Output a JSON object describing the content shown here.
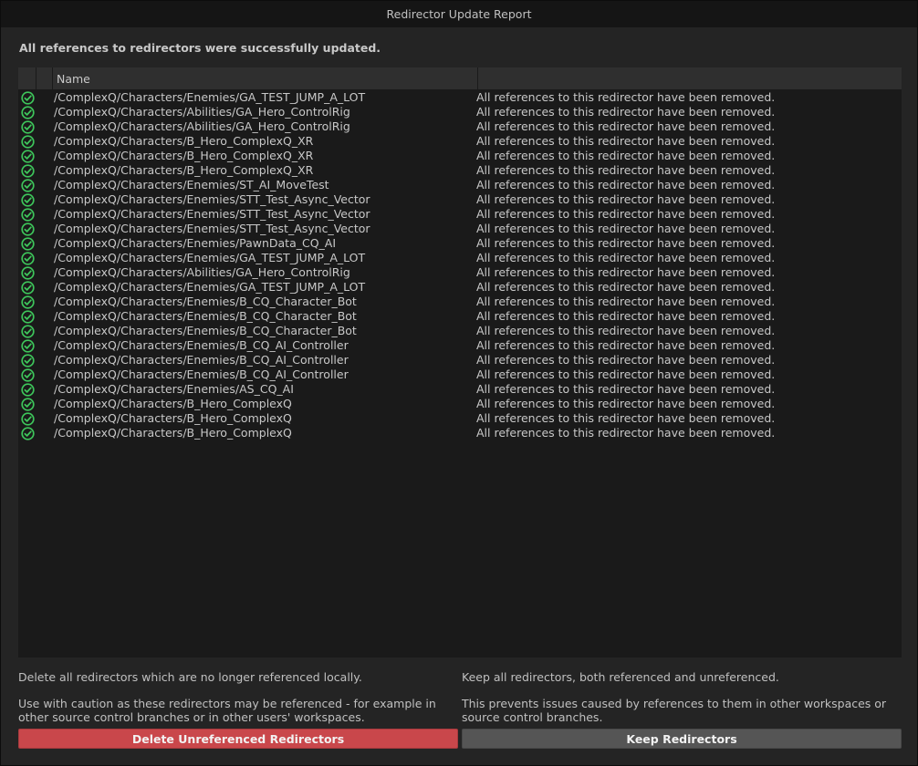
{
  "window": {
    "title": "Redirector Update Report"
  },
  "summary": "All references to redirectors were successfully updated.",
  "table": {
    "columns": {
      "name": "Name",
      "message": ""
    },
    "rows": [
      {
        "name": "/ComplexQ/Characters/Enemies/GA_TEST_JUMP_A_LOT",
        "message": "All references to this redirector have been removed."
      },
      {
        "name": "/ComplexQ/Characters/Abilities/GA_Hero_ControlRig",
        "message": "All references to this redirector have been removed."
      },
      {
        "name": "/ComplexQ/Characters/Abilities/GA_Hero_ControlRig",
        "message": "All references to this redirector have been removed."
      },
      {
        "name": "/ComplexQ/Characters/B_Hero_ComplexQ_XR",
        "message": "All references to this redirector have been removed."
      },
      {
        "name": "/ComplexQ/Characters/B_Hero_ComplexQ_XR",
        "message": "All references to this redirector have been removed."
      },
      {
        "name": "/ComplexQ/Characters/B_Hero_ComplexQ_XR",
        "message": "All references to this redirector have been removed."
      },
      {
        "name": "/ComplexQ/Characters/Enemies/ST_AI_MoveTest",
        "message": "All references to this redirector have been removed."
      },
      {
        "name": "/ComplexQ/Characters/Enemies/STT_Test_Async_Vector",
        "message": "All references to this redirector have been removed."
      },
      {
        "name": "/ComplexQ/Characters/Enemies/STT_Test_Async_Vector",
        "message": "All references to this redirector have been removed."
      },
      {
        "name": "/ComplexQ/Characters/Enemies/STT_Test_Async_Vector",
        "message": "All references to this redirector have been removed."
      },
      {
        "name": "/ComplexQ/Characters/Enemies/PawnData_CQ_AI",
        "message": "All references to this redirector have been removed."
      },
      {
        "name": "/ComplexQ/Characters/Enemies/GA_TEST_JUMP_A_LOT",
        "message": "All references to this redirector have been removed."
      },
      {
        "name": "/ComplexQ/Characters/Abilities/GA_Hero_ControlRig",
        "message": "All references to this redirector have been removed."
      },
      {
        "name": "/ComplexQ/Characters/Enemies/GA_TEST_JUMP_A_LOT",
        "message": "All references to this redirector have been removed."
      },
      {
        "name": "/ComplexQ/Characters/Enemies/B_CQ_Character_Bot",
        "message": "All references to this redirector have been removed."
      },
      {
        "name": "/ComplexQ/Characters/Enemies/B_CQ_Character_Bot",
        "message": "All references to this redirector have been removed."
      },
      {
        "name": "/ComplexQ/Characters/Enemies/B_CQ_Character_Bot",
        "message": "All references to this redirector have been removed."
      },
      {
        "name": "/ComplexQ/Characters/Enemies/B_CQ_AI_Controller",
        "message": "All references to this redirector have been removed."
      },
      {
        "name": "/ComplexQ/Characters/Enemies/B_CQ_AI_Controller",
        "message": "All references to this redirector have been removed."
      },
      {
        "name": "/ComplexQ/Characters/Enemies/B_CQ_AI_Controller",
        "message": "All references to this redirector have been removed."
      },
      {
        "name": "/ComplexQ/Characters/Enemies/AS_CQ_AI",
        "message": "All references to this redirector have been removed."
      },
      {
        "name": "/ComplexQ/Characters/B_Hero_ComplexQ",
        "message": "All references to this redirector have been removed."
      },
      {
        "name": "/ComplexQ/Characters/B_Hero_ComplexQ",
        "message": "All references to this redirector have been removed."
      },
      {
        "name": "/ComplexQ/Characters/B_Hero_ComplexQ",
        "message": "All references to this redirector have been removed."
      }
    ],
    "status_icon": "check-circle-icon"
  },
  "delete_section": {
    "line1": "Delete all redirectors which are no longer referenced locally.",
    "line2": "Use with caution as these redirectors may be referenced - for example in other source control branches or in other users' workspaces.",
    "button_label": "Delete Unreferenced Redirectors"
  },
  "keep_section": {
    "line1": "Keep all redirectors, both referenced and unreferenced.",
    "line2": "This prevents issues caused by references to them in other workspaces or source control branches.",
    "button_label": "Keep Redirectors"
  },
  "colors": {
    "success": "#3ec65b",
    "danger": "#c9474b",
    "neutral": "#555555"
  }
}
